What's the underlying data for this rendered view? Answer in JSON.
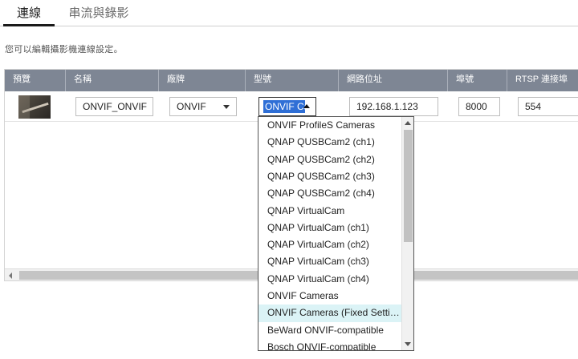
{
  "tabs": [
    {
      "label": "連線",
      "active": true
    },
    {
      "label": "串流與錄影",
      "active": false
    }
  ],
  "description": "您可以編輯攝影機連線設定。",
  "table": {
    "headers": [
      "預覽",
      "名稱",
      "廠牌",
      "型號",
      "網路位址",
      "埠號",
      "RTSP 連接埠"
    ],
    "row": {
      "name": "ONVIF_ONVIF",
      "brand": "ONVIF",
      "model": "ONVIF Ca",
      "ip": "192.168.1.123",
      "port": "8000",
      "rtsp_port": "554"
    }
  },
  "dropdown": {
    "items": [
      "ONVIF ProfileS Cameras",
      "QNAP QUSBCam2 (ch1)",
      "QNAP QUSBCam2 (ch2)",
      "QNAP QUSBCam2 (ch3)",
      "QNAP QUSBCam2 (ch4)",
      "QNAP VirtualCam",
      "QNAP VirtualCam (ch1)",
      "QNAP VirtualCam (ch2)",
      "QNAP VirtualCam (ch3)",
      "QNAP VirtualCam (ch4)",
      "ONVIF Cameras",
      "ONVIF Cameras (Fixed Setti…",
      "BeWard ONVIF-compatible",
      "Bosch ONVIF-compatible"
    ],
    "highlighted_index": 11
  },
  "colors": {
    "header_bg": "#7e8694",
    "selection_bg": "#2f6fd6",
    "hover_bg": "#dbf3f6"
  }
}
